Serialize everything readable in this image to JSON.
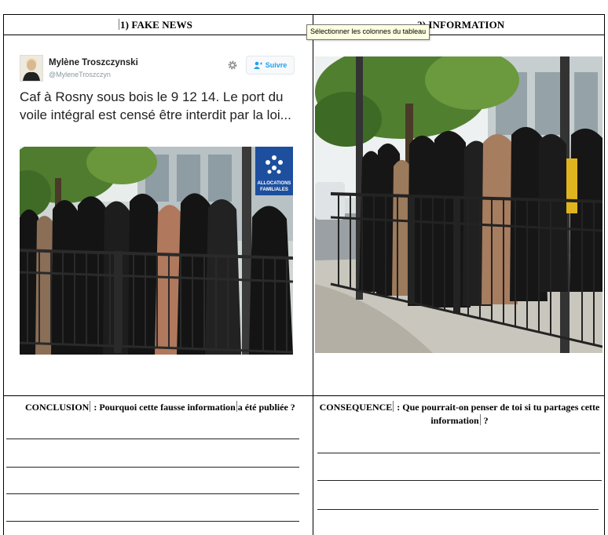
{
  "headers": {
    "left": "1) FAKE NEWS",
    "right": "2) INFORMATION"
  },
  "tooltip": "Sélectionner les colonnes du tableau",
  "tweet": {
    "author_name": "Mylène Troszczynski",
    "author_handle": "@MyleneTroszczyn",
    "follow_label": "Suivre",
    "text": "Caf à Rosny sous bois le 9 12 14. Le port du voile intégral est censé être interdit par la loi..."
  },
  "photo_sign": {
    "line1": "ALLOCATIONS",
    "line2": "FAMILIALES"
  },
  "conclusion": {
    "label": "CONCLUSION",
    "question_a": " : Pourquoi cette fausse information",
    "question_b": "a été publiée ?"
  },
  "consequence": {
    "label": "CONSEQUENCE",
    "question_a": " :  Que pourrait-on penser de toi si tu partages cette",
    "question_b": "information",
    "question_c": " ?"
  },
  "colors": {
    "tooltip_bg": "#ffffe1",
    "follow_blue": "#1da1f2",
    "sign_blue": "#1d4f9e"
  },
  "icons": [
    "gear-icon",
    "follow-person-icon"
  ]
}
